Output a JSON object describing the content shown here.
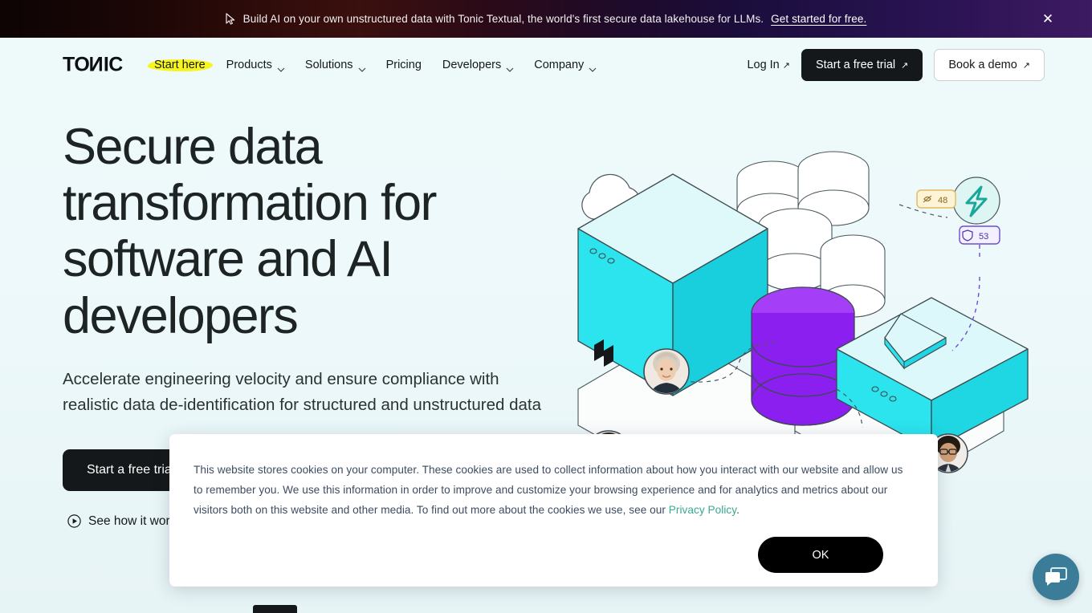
{
  "promo": {
    "icon": "cursor-icon",
    "text": "Build AI on your own unstructured data with Tonic Textual, the world's first secure data lakehouse for LLMs.",
    "link_label": "Get started for free.",
    "close_label": "✕",
    "gradient_from": "#0d0404",
    "gradient_to": "#3d1a63"
  },
  "header": {
    "logo": {
      "prefix": "TO",
      "mirrored": "N",
      "suffix": "IC"
    },
    "nav": [
      {
        "label": "Start here",
        "has_caret": false,
        "highlighted": true
      },
      {
        "label": "Products",
        "has_caret": true,
        "highlighted": false
      },
      {
        "label": "Solutions",
        "has_caret": true,
        "highlighted": false
      },
      {
        "label": "Pricing",
        "has_caret": false,
        "highlighted": false
      },
      {
        "label": "Developers",
        "has_caret": true,
        "highlighted": false
      },
      {
        "label": "Company",
        "has_caret": true,
        "highlighted": false
      }
    ],
    "highlight_color": "#f7f51c",
    "login_label": "Log In",
    "login_arrow": "↗",
    "trial_button": "Start a free trial",
    "trial_arrow": "↗",
    "demo_button": "Book a demo",
    "demo_arrow": "↗"
  },
  "hero": {
    "title": "Secure data transformation for software and AI developers",
    "subtitle": "Accelerate engineering velocity and ensure compliance with realistic data de-identification for structured and unstructured data",
    "primary_cta": "Start a free trial",
    "primary_arrow": "↗",
    "secondary_cta": "See how it works",
    "secondary_icon": "play-circle-icon",
    "background_color": "#eefafa"
  },
  "illustration": {
    "name": "isometric-data-platform-illustration",
    "badges": [
      {
        "name": "badge-48",
        "value": "48",
        "icon": "eye-off-icon",
        "fill": "#fdf3d7",
        "border": "#e0b95f",
        "text_color": "#8a6a1c"
      },
      {
        "name": "badge-53",
        "value": "53",
        "icon": "shield-icon",
        "fill": "#f3f0ff",
        "border": "#6d4cd6",
        "text_color": "#4a32a8"
      }
    ],
    "bolt_icon": "lightning-bolt-icon",
    "colors": {
      "cube_front": "#2be4ee",
      "cube_side": "#18cfdd",
      "cube_top": "#dff8fa",
      "cylinder_purple": "#8b1ff0",
      "cylinder_purple_top": "#a43ff7",
      "slab_top": "#ddf8fa",
      "slab_front": "#2ce4ee",
      "outline": "#3c4a4f"
    },
    "avatars": [
      "avatar-woman-blonde",
      "avatar-man-dark",
      "avatar-man-glasses"
    ]
  },
  "cookie_dialog": {
    "body_part1": "This website stores cookies on your computer. These cookies are used to collect information about how you interact with our website and allow us to remember you. We use this information in order to improve and customize your browsing experience and for analytics and metrics about our visitors both on this website and other media. To find out more about the cookies we use, see our ",
    "link_label": "Privacy Policy",
    "body_part2": ".",
    "ok_button": "OK",
    "link_color": "#3aa98f"
  },
  "chat": {
    "icon": "chat-bubbles-icon",
    "color": "#3b7d99"
  }
}
